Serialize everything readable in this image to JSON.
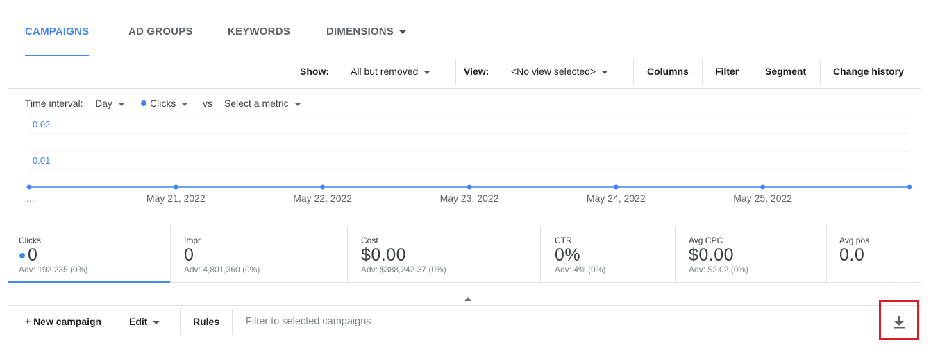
{
  "tabs": [
    {
      "label": "CAMPAIGNS",
      "active": true
    },
    {
      "label": "AD GROUPS",
      "active": false
    },
    {
      "label": "KEYWORDS",
      "active": false
    },
    {
      "label": "DIMENSIONS",
      "active": false
    }
  ],
  "toolbar": {
    "show_label": "Show:",
    "show_value": "All but removed",
    "view_label": "View:",
    "view_value": "<No view selected>",
    "columns": "Columns",
    "filter": "Filter",
    "segment": "Segment",
    "change_history": "Change history"
  },
  "chart_controls": {
    "time_interval_label": "Time interval:",
    "time_interval_value": "Day",
    "metric1": "Clicks",
    "vs": "vs",
    "metric2": "Select a metric"
  },
  "chart_data": {
    "type": "line",
    "x_labels": [
      "...",
      "May 21, 2022",
      "May 22, 2022",
      "May 23, 2022",
      "May 24, 2022",
      "May 25, 2022",
      ""
    ],
    "y_ticks": [
      "0.02",
      "0.01"
    ],
    "series": [
      {
        "name": "Clicks",
        "values": [
          0,
          0,
          0,
          0,
          0,
          0,
          0
        ]
      }
    ],
    "ylim": [
      0,
      0.02
    ],
    "grid": true,
    "color": "#4285f4"
  },
  "scorecards": [
    {
      "name": "Clicks",
      "value": "0",
      "adv": "Adv: 192,235 (0%)",
      "active": true
    },
    {
      "name": "Impr",
      "value": "0",
      "adv": "Adv: 4,801,360 (0%)",
      "active": false
    },
    {
      "name": "Cost",
      "value": "$0.00",
      "adv": "Adv: $388,242.37 (0%)",
      "active": false
    },
    {
      "name": "CTR",
      "value": "0%",
      "adv": "Adv: 4% (0%)",
      "active": false
    },
    {
      "name": "Avg CPC",
      "value": "$0.00",
      "adv": "Adv: $2.02 (0%)",
      "active": false
    },
    {
      "name": "Avg pos",
      "value": "0.0",
      "adv": "",
      "active": false
    }
  ],
  "bottombar": {
    "new_campaign": "+ New campaign",
    "edit": "Edit",
    "rules": "Rules",
    "filter_placeholder": "Filter to selected campaigns"
  },
  "icons": {
    "download": "download-icon",
    "collapse": "chevron-up-icon"
  },
  "colors": {
    "accent": "#4285f4",
    "highlight": "#e01b24"
  }
}
